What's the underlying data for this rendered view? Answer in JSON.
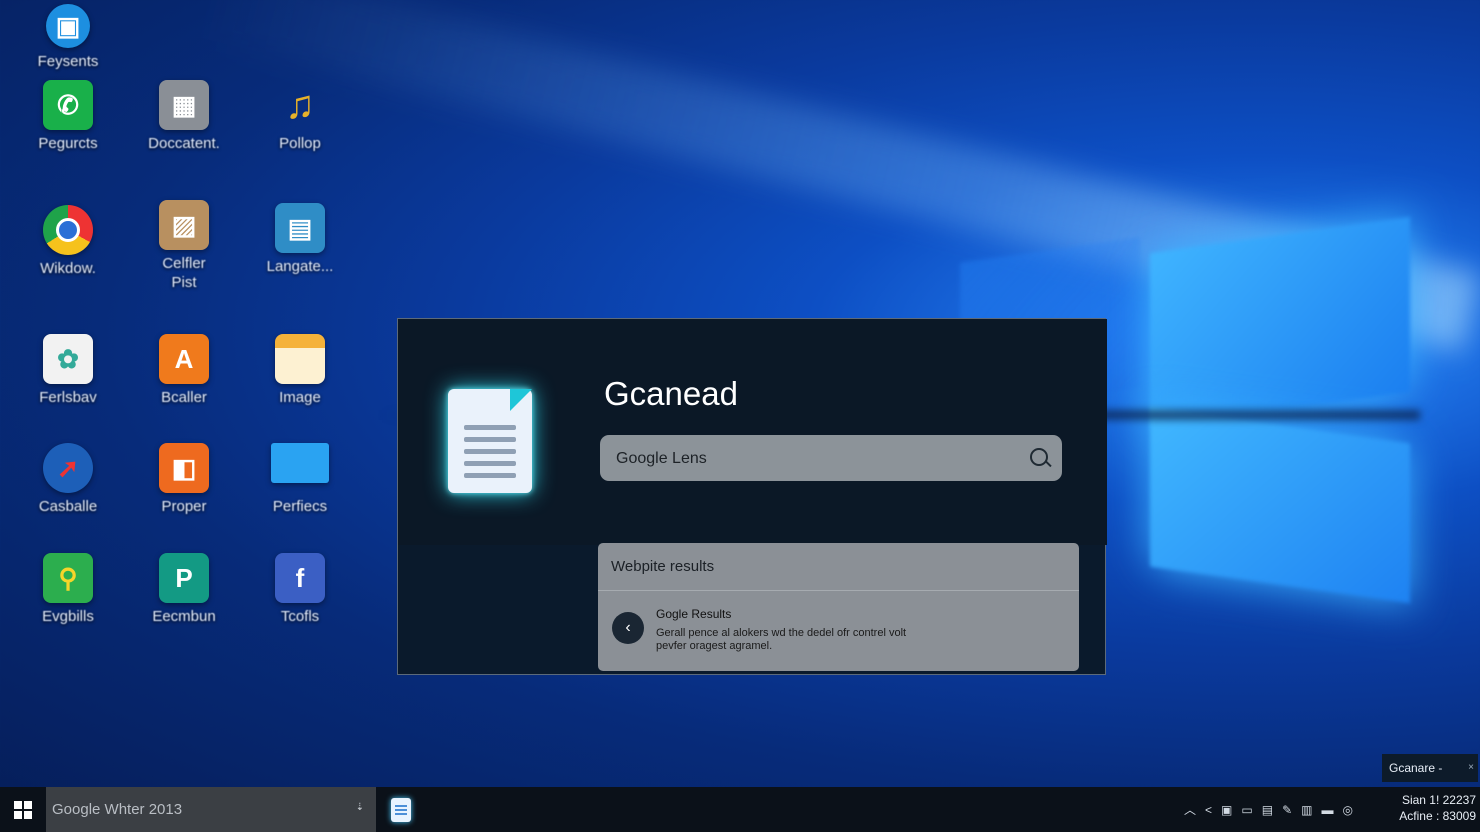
{
  "desktop": {
    "icons": [
      {
        "label": "Feysents",
        "icon": "folder-icon",
        "color": "#1d8fe0"
      },
      {
        "label": "Pegurcts",
        "icon": "phone-icon",
        "color": "#19b04a"
      },
      {
        "label": "Doccatent.",
        "icon": "calculator-icon",
        "color": "#8a8f96"
      },
      {
        "label": "Pollop",
        "icon": "music-icon",
        "color": "#d9a020"
      },
      {
        "label": "Wikdow.",
        "icon": "chrome-icon",
        "color": "#2c2c2c"
      },
      {
        "label": "Celfler\nPist",
        "icon": "photo-icon",
        "color": "#b89060"
      },
      {
        "label": "Langate...",
        "icon": "document-icon",
        "color": "#2f8dc6"
      },
      {
        "label": "Ferlsbav",
        "icon": "photos-icon",
        "color": "#f2f2f2"
      },
      {
        "label": "Bcaller",
        "icon": "app-icon",
        "color": "#f07a1c"
      },
      {
        "label": "Image",
        "icon": "folder-icon",
        "color": "#f5c542"
      },
      {
        "label": "Casballe",
        "icon": "compass-icon",
        "color": "#1d5fb8"
      },
      {
        "label": "Proper",
        "icon": "office-icon",
        "color": "#ee6a1f"
      },
      {
        "label": "Perfiecs",
        "icon": "monitor-icon",
        "color": "#2aa3f2"
      },
      {
        "label": "Evgbills",
        "icon": "maps-icon",
        "color": "#2cae4e"
      },
      {
        "label": "Eecmbun",
        "icon": "publisher-icon",
        "color": "#139a84"
      },
      {
        "label": "Tcofls",
        "icon": "facebook-icon",
        "color": "#3b5fc4"
      }
    ]
  },
  "search_window": {
    "title": "Gcanead",
    "search_placeholder": "Google Lens",
    "results_header": "Webpite results",
    "result": {
      "title": "Gogle Results",
      "description": "Gerall pence al alokers wd the dedel ofr contrel volt pevfer oragest agramel."
    }
  },
  "toast": {
    "text": "Gcanare -",
    "close": "×"
  },
  "taskbar": {
    "search_text": "Google Whter 2013",
    "mic": "⇣",
    "clock_line1": "Sian 1! 22237",
    "clock_line2": "Acfine : 83009"
  },
  "colors": {
    "accent": "#1e82f2",
    "doc_glow": "#30d6e8"
  }
}
